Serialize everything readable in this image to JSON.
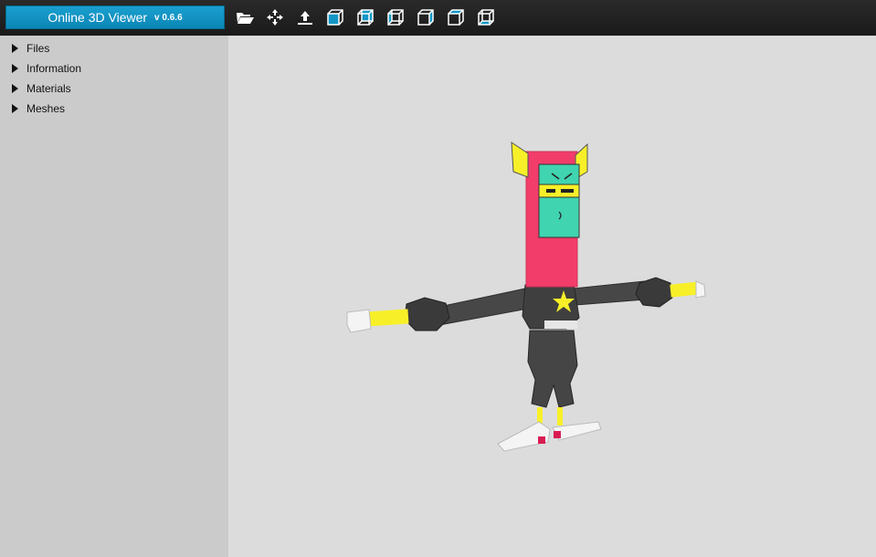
{
  "app": {
    "title": "Online 3D Viewer",
    "version": "v 0.6.6"
  },
  "toolbar": [
    {
      "name": "open-icon"
    },
    {
      "name": "fit-to-window-icon"
    },
    {
      "name": "set-up-vector-icon"
    },
    {
      "name": "view-front-icon"
    },
    {
      "name": "view-back-icon"
    },
    {
      "name": "view-left-icon"
    },
    {
      "name": "view-right-icon"
    },
    {
      "name": "view-top-icon"
    },
    {
      "name": "view-bottom-icon"
    }
  ],
  "sidebar": {
    "items": [
      {
        "label": "Files"
      },
      {
        "label": "Information"
      },
      {
        "label": "Materials"
      },
      {
        "label": "Meshes"
      }
    ]
  },
  "colors": {
    "accent": "#1296c6",
    "topbar": "#1f1f1f",
    "sidebar": "#cbcbcb",
    "viewport": "#dcdcdc"
  }
}
